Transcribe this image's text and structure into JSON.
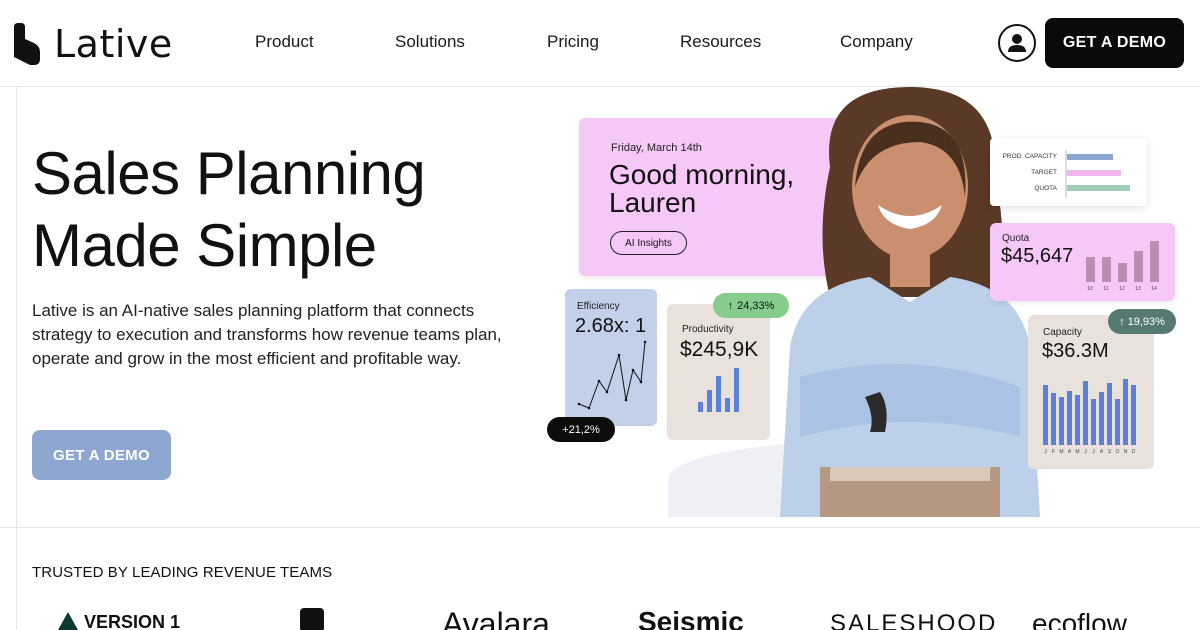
{
  "brand": {
    "name": "Lative"
  },
  "nav": {
    "items": [
      "Product",
      "Solutions",
      "Pricing",
      "Resources",
      "Company"
    ],
    "cta": "GET A DEMO"
  },
  "hero": {
    "title_line1": "Sales Planning",
    "title_line2": "Made Simple",
    "description": "Lative is an AI-native sales planning platform that connects strategy to execution and transforms how revenue teams plan, operate and grow in the most efficient and profitable way.",
    "cta": "GET A DEMO"
  },
  "dashboard": {
    "greeting": {
      "date": "Friday, March 14th",
      "line1": "Good morning,",
      "line2": "Lauren",
      "button": "AI Insights"
    },
    "efficiency": {
      "label": "Efficiency",
      "value": "2.68x: 1",
      "badge": "+21,2%"
    },
    "productivity": {
      "label": "Productivity",
      "value": "$245,9K",
      "badge": "24,33%"
    },
    "mini_capacity": {
      "rows": [
        "PROD. CAPACITY",
        "TARGET",
        "QUOTA"
      ]
    },
    "quota": {
      "label": "Quota",
      "value": "$45,647",
      "ticks": [
        "10",
        "11",
        "12",
        "13",
        "14"
      ]
    },
    "capacity": {
      "label": "Capacity",
      "value": "$36.3M",
      "badge": "19,93%",
      "ticks": [
        "J",
        "F",
        "M",
        "A",
        "M",
        "J",
        "J",
        "A",
        "S",
        "O",
        "N",
        "D"
      ]
    }
  },
  "trusted": {
    "heading": "TRUSTED BY LEADING REVENUE TEAMS",
    "logos": [
      "VERSION 1",
      "intercom",
      "Avalara",
      "Seismic",
      "SALESHOOD",
      "ecoflow"
    ]
  },
  "colors": {
    "accent_pink": "#f6c8f8",
    "accent_blue": "#8da7d1",
    "chart_blue": "#5b82d6",
    "dark": "#0a0a0a"
  }
}
